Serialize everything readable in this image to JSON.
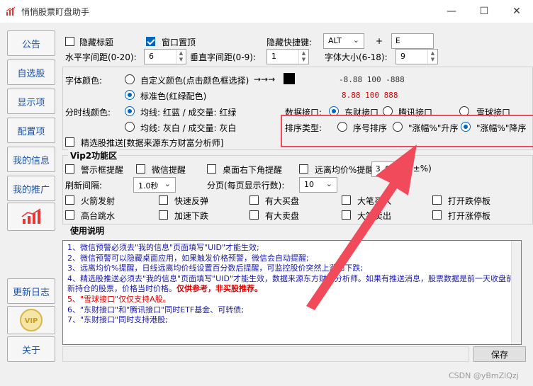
{
  "window": {
    "title": "悄悄股票盯盘助手",
    "minimize": "—",
    "maximize": "☐",
    "close": "✕"
  },
  "sidebar": {
    "items": [
      {
        "label": "公告"
      },
      {
        "label": "自选股"
      },
      {
        "label": "显示项"
      },
      {
        "label": "配置项"
      },
      {
        "label": "我的信息"
      },
      {
        "label": "我的推广"
      },
      {
        "label": "",
        "icon": "signal-bars-icon"
      },
      {
        "label": "更新日志"
      },
      {
        "label": "VIP",
        "icon": "vip-badge-icon"
      },
      {
        "label": "关于"
      }
    ]
  },
  "settings": {
    "hide_title": {
      "label": "隐藏标题",
      "checked": false
    },
    "window_top": {
      "label": "窗口置顶",
      "checked": true
    },
    "hide_hotkey": {
      "label": "隐藏快捷键:",
      "modifier": "ALT",
      "plus": "+",
      "key": "E"
    },
    "h_spacing": {
      "label": "水平字间距(0-20):",
      "value": "6"
    },
    "v_spacing": {
      "label": "垂直字间距(0-9):",
      "value": "1"
    },
    "font_size": {
      "label": "字体大小(6-18):",
      "value": "9"
    },
    "font_color": {
      "label": "字体颜色:",
      "custom": {
        "label": "自定义颜色(点击颜色框选择)",
        "arrow": "→→→",
        "checked": false,
        "swatch": "#000000",
        "sample": "-8.88  100  -888"
      },
      "standard": {
        "label": "标准色(红绿配色)",
        "checked": true,
        "sample": "8.88  100  888"
      }
    },
    "timeline_color": {
      "label": "分时线颜色:",
      "opt1": {
        "label": "均线: 红蓝 / 成交量: 红绿",
        "checked": true
      },
      "opt2": {
        "label": "均线: 灰白 / 成交量: 灰白",
        "checked": false
      }
    },
    "data_api": {
      "label": "数据接口:",
      "options": [
        {
          "label": "东财接口",
          "checked": true
        },
        {
          "label": "腾讯接口",
          "checked": false
        },
        {
          "label": "雪球接口",
          "checked": false
        }
      ]
    },
    "sort_type": {
      "label": "排序类型:",
      "options": [
        {
          "label": "序号排序",
          "checked": false
        },
        {
          "label": "\"涨幅%\"升序",
          "checked": false
        },
        {
          "label": "\"涨幅%\"降序",
          "checked": true
        }
      ]
    },
    "push": {
      "label": "精选股推送[数据来源东方财富分析师]",
      "checked": false
    }
  },
  "vip2": {
    "title": "Vip2功能区",
    "row1": [
      {
        "label": "警示框提醒"
      },
      {
        "label": "微信提醒"
      },
      {
        "label": "桌面右下角提醒"
      },
      {
        "label": "远离均价%提醒"
      }
    ],
    "far_avg_value": "3.0",
    "far_avg_unit": "(±%)",
    "refresh": {
      "label": "刷新间隔:",
      "value": "1.0秒"
    },
    "page": {
      "label": "分页(每页显示行数):",
      "value": "10"
    },
    "row3": [
      {
        "label": "火箭发射"
      },
      {
        "label": "快速反弹"
      },
      {
        "label": "有大买盘"
      },
      {
        "label": "大笔买入"
      },
      {
        "label": "打开跌停板"
      }
    ],
    "row4": [
      {
        "label": "高台跳水"
      },
      {
        "label": "加速下跌"
      },
      {
        "label": "有大卖盘"
      },
      {
        "label": "大笔卖出"
      },
      {
        "label": "打开涨停板"
      }
    ]
  },
  "usage": {
    "title": "使用说明",
    "lines": [
      "1、微信预警必须去\"我的信息\"页面填写\"UID\"才能生效;",
      "2、微信预警可以隐藏桌面应用，如果触发价格预警，微信会自动提醒;",
      "3、远离均价%提醒，日线远离均价线设置百分数后提醒，可监控股价突然上涨和下跌;",
      "4、精选股推送必须去\"我的信息\"页面填写\"UID\"才能生效，数据来源东方财富分析师。如果有推送消息，股票数据是前一天收盘前新持仓的股票，价格当时价格。",
      "仅供参考，非买股推荐。",
      "5、\"雪球接口\"仅仅支持A股。",
      "6、\"东财接口\"和\"腾讯接口\"同时ETF基金、可转债;",
      "7、\"东财接口\"同时支持港股;"
    ]
  },
  "save_label": "保存",
  "watermark": "CSDN @yBmZlQzj"
}
